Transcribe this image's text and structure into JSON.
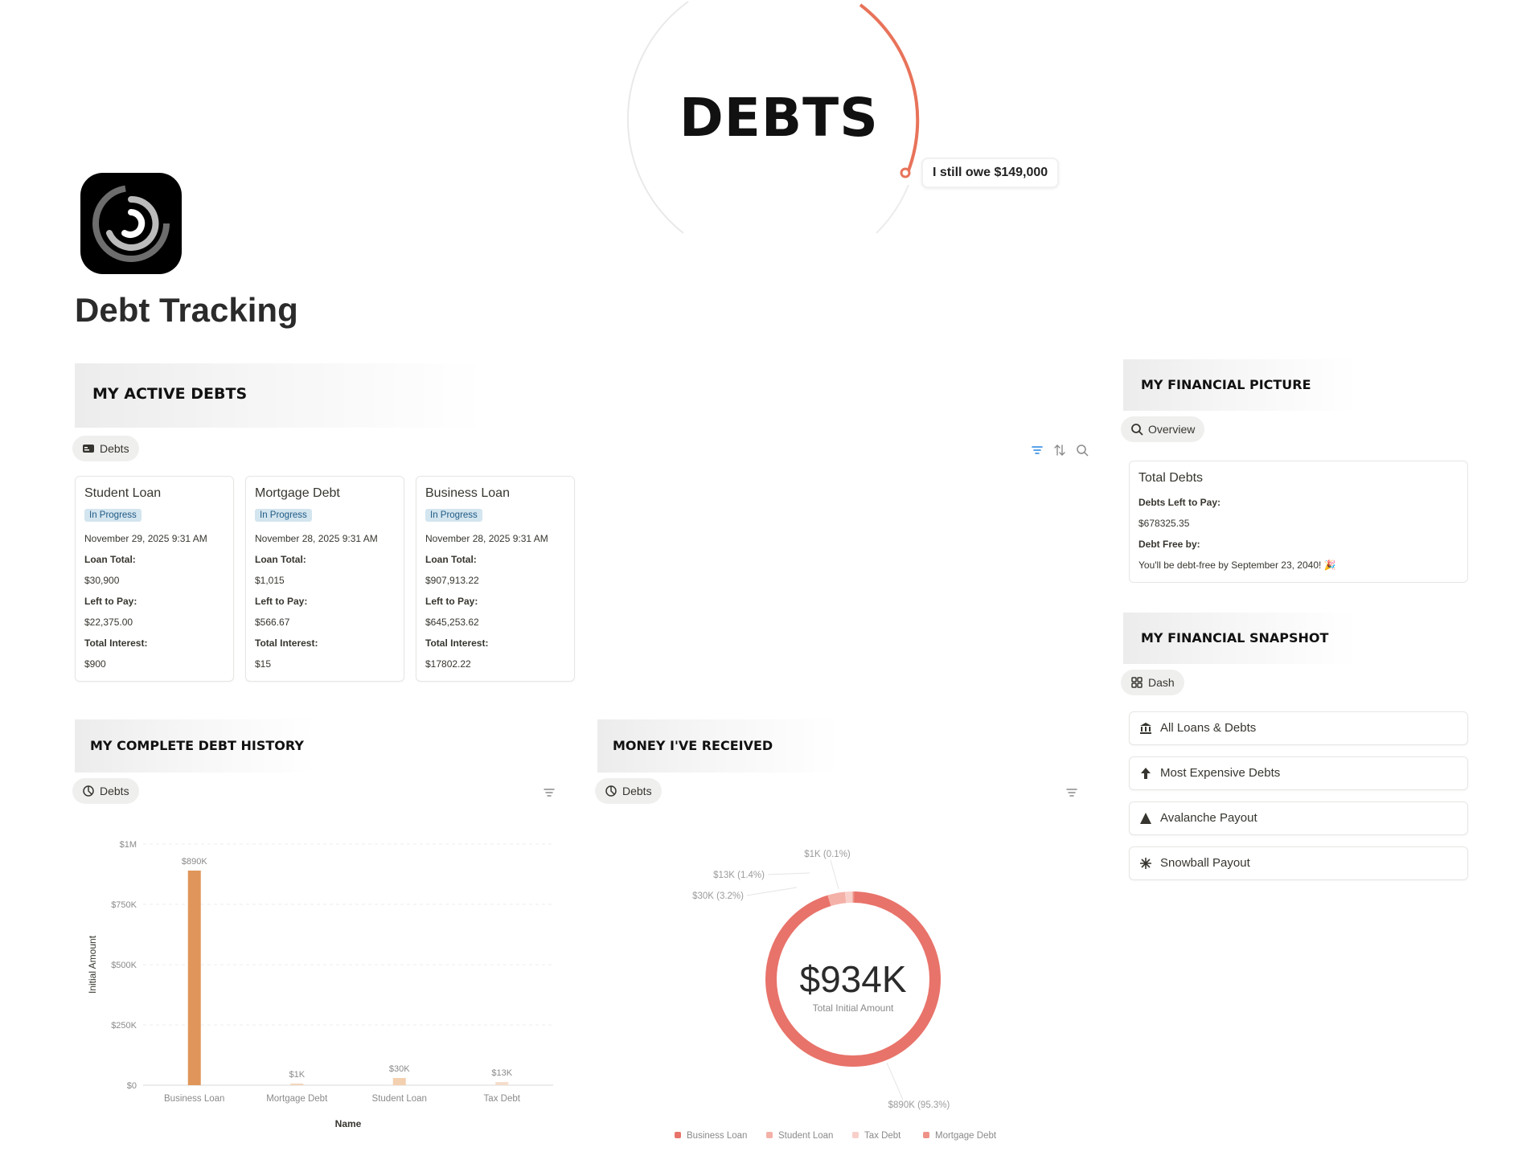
{
  "cover": {
    "title": "DEBTS",
    "badge": "I still owe $149,000"
  },
  "page": {
    "title": "Debt Tracking"
  },
  "active_debts": {
    "heading": "MY ACTIVE DEBTS",
    "view_label": "Debts",
    "cards": [
      {
        "name": "Student Loan",
        "status": "In Progress",
        "date": "November 29, 2025 9:31 AM",
        "loan_total_label": "Loan Total:",
        "loan_total": "$30,900",
        "left_label": "Left to Pay:",
        "left": "$22,375.00",
        "interest_label": "Total Interest:",
        "interest": "$900"
      },
      {
        "name": "Mortgage Debt",
        "status": "In Progress",
        "date": "November 28, 2025 9:31 AM",
        "loan_total_label": "Loan Total:",
        "loan_total": "$1,015",
        "left_label": "Left to Pay:",
        "left": "$566.67",
        "interest_label": "Total Interest:",
        "interest": "$15"
      },
      {
        "name": "Business Loan",
        "status": "In Progress",
        "date": "November 28, 2025 9:31 AM",
        "loan_total_label": "Loan Total:",
        "loan_total": "$907,913.22",
        "left_label": "Left to Pay:",
        "left": "$645,253.62",
        "interest_label": "Total Interest:",
        "interest": "$17802.22"
      }
    ]
  },
  "financial_picture": {
    "heading": "MY FINANCIAL PICTURE",
    "view_label": "Overview",
    "card_title": "Total Debts",
    "left_label": "Debts Left to Pay:",
    "left_value": "$678325.35",
    "free_label": "Debt Free by:",
    "free_value": "You'll be debt-free by September 23, 2040! 🎉"
  },
  "snapshot": {
    "heading": "MY FINANCIAL SNAPSHOT",
    "view_label": "Dash",
    "links": [
      {
        "label": "All Loans & Debts",
        "icon": "bank-icon"
      },
      {
        "label": "Most Expensive Debts",
        "icon": "arrow-up-icon"
      },
      {
        "label": "Avalanche Payout",
        "icon": "triangle-icon"
      },
      {
        "label": "Snowball Payout",
        "icon": "snowflake-icon"
      }
    ]
  },
  "history": {
    "heading": "MY COMPLETE DEBT HISTORY",
    "view_label": "Debts"
  },
  "received": {
    "heading": "MONEY I'VE RECEIVED",
    "view_label": "Debts"
  },
  "chart_data": [
    {
      "type": "bar",
      "categories": [
        "Business Loan",
        "Mortgage Debt",
        "Student Loan",
        "Tax Debt"
      ],
      "values": [
        890000,
        1000,
        30000,
        13000
      ],
      "value_labels": [
        "$890K",
        "$1K",
        "$30K",
        "$13K"
      ],
      "colors": [
        "#e0965a",
        "#f3d4ba",
        "#f3d0b0",
        "#f5dccb"
      ],
      "xlabel": "Name",
      "ylabel": "Initial Amount",
      "ylim": [
        0,
        1000000
      ],
      "yticks": [
        0,
        250000,
        500000,
        750000,
        1000000
      ],
      "ytick_labels": [
        "$0",
        "$250K",
        "$500K",
        "$750K",
        "$1M"
      ],
      "grid": true
    },
    {
      "type": "pie",
      "donut": true,
      "center_value": "$934K",
      "center_label": "Total Initial Amount",
      "slices": [
        {
          "name": "Business Loan",
          "value": 890000,
          "label": "$890K (95.3%)",
          "color": "#e8736a"
        },
        {
          "name": "Student Loan",
          "value": 30000,
          "label": "$30K (3.2%)",
          "color": "#f4b1a8"
        },
        {
          "name": "Tax Debt",
          "value": 13000,
          "label": "$13K (1.4%)",
          "color": "#f8cfc9"
        },
        {
          "name": "Mortgage Debt",
          "value": 1000,
          "label": "$1K (0.1%)",
          "color": "#ee9288"
        }
      ],
      "legend": [
        "Business Loan",
        "Student Loan",
        "Tax Debt",
        "Mortgage Debt"
      ],
      "legend_position": "bottom"
    }
  ]
}
